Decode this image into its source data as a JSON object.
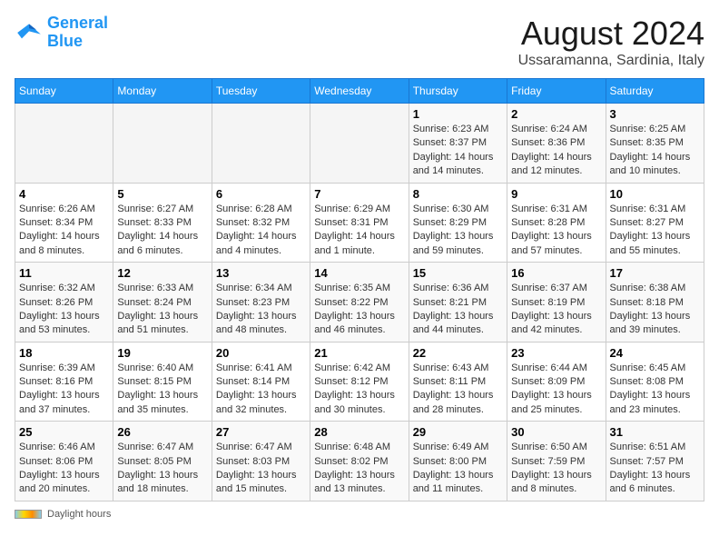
{
  "logo": {
    "line1": "General",
    "line2": "Blue"
  },
  "title": {
    "month_year": "August 2024",
    "location": "Ussaramanna, Sardinia, Italy"
  },
  "days_of_week": [
    "Sunday",
    "Monday",
    "Tuesday",
    "Wednesday",
    "Thursday",
    "Friday",
    "Saturday"
  ],
  "weeks": [
    [
      {
        "day": "",
        "info": ""
      },
      {
        "day": "",
        "info": ""
      },
      {
        "day": "",
        "info": ""
      },
      {
        "day": "",
        "info": ""
      },
      {
        "day": "1",
        "info": "Sunrise: 6:23 AM\nSunset: 8:37 PM\nDaylight: 14 hours\nand 14 minutes."
      },
      {
        "day": "2",
        "info": "Sunrise: 6:24 AM\nSunset: 8:36 PM\nDaylight: 14 hours\nand 12 minutes."
      },
      {
        "day": "3",
        "info": "Sunrise: 6:25 AM\nSunset: 8:35 PM\nDaylight: 14 hours\nand 10 minutes."
      }
    ],
    [
      {
        "day": "4",
        "info": "Sunrise: 6:26 AM\nSunset: 8:34 PM\nDaylight: 14 hours\nand 8 minutes."
      },
      {
        "day": "5",
        "info": "Sunrise: 6:27 AM\nSunset: 8:33 PM\nDaylight: 14 hours\nand 6 minutes."
      },
      {
        "day": "6",
        "info": "Sunrise: 6:28 AM\nSunset: 8:32 PM\nDaylight: 14 hours\nand 4 minutes."
      },
      {
        "day": "7",
        "info": "Sunrise: 6:29 AM\nSunset: 8:31 PM\nDaylight: 14 hours\nand 1 minute."
      },
      {
        "day": "8",
        "info": "Sunrise: 6:30 AM\nSunset: 8:29 PM\nDaylight: 13 hours\nand 59 minutes."
      },
      {
        "day": "9",
        "info": "Sunrise: 6:31 AM\nSunset: 8:28 PM\nDaylight: 13 hours\nand 57 minutes."
      },
      {
        "day": "10",
        "info": "Sunrise: 6:31 AM\nSunset: 8:27 PM\nDaylight: 13 hours\nand 55 minutes."
      }
    ],
    [
      {
        "day": "11",
        "info": "Sunrise: 6:32 AM\nSunset: 8:26 PM\nDaylight: 13 hours\nand 53 minutes."
      },
      {
        "day": "12",
        "info": "Sunrise: 6:33 AM\nSunset: 8:24 PM\nDaylight: 13 hours\nand 51 minutes."
      },
      {
        "day": "13",
        "info": "Sunrise: 6:34 AM\nSunset: 8:23 PM\nDaylight: 13 hours\nand 48 minutes."
      },
      {
        "day": "14",
        "info": "Sunrise: 6:35 AM\nSunset: 8:22 PM\nDaylight: 13 hours\nand 46 minutes."
      },
      {
        "day": "15",
        "info": "Sunrise: 6:36 AM\nSunset: 8:21 PM\nDaylight: 13 hours\nand 44 minutes."
      },
      {
        "day": "16",
        "info": "Sunrise: 6:37 AM\nSunset: 8:19 PM\nDaylight: 13 hours\nand 42 minutes."
      },
      {
        "day": "17",
        "info": "Sunrise: 6:38 AM\nSunset: 8:18 PM\nDaylight: 13 hours\nand 39 minutes."
      }
    ],
    [
      {
        "day": "18",
        "info": "Sunrise: 6:39 AM\nSunset: 8:16 PM\nDaylight: 13 hours\nand 37 minutes."
      },
      {
        "day": "19",
        "info": "Sunrise: 6:40 AM\nSunset: 8:15 PM\nDaylight: 13 hours\nand 35 minutes."
      },
      {
        "day": "20",
        "info": "Sunrise: 6:41 AM\nSunset: 8:14 PM\nDaylight: 13 hours\nand 32 minutes."
      },
      {
        "day": "21",
        "info": "Sunrise: 6:42 AM\nSunset: 8:12 PM\nDaylight: 13 hours\nand 30 minutes."
      },
      {
        "day": "22",
        "info": "Sunrise: 6:43 AM\nSunset: 8:11 PM\nDaylight: 13 hours\nand 28 minutes."
      },
      {
        "day": "23",
        "info": "Sunrise: 6:44 AM\nSunset: 8:09 PM\nDaylight: 13 hours\nand 25 minutes."
      },
      {
        "day": "24",
        "info": "Sunrise: 6:45 AM\nSunset: 8:08 PM\nDaylight: 13 hours\nand 23 minutes."
      }
    ],
    [
      {
        "day": "25",
        "info": "Sunrise: 6:46 AM\nSunset: 8:06 PM\nDaylight: 13 hours\nand 20 minutes."
      },
      {
        "day": "26",
        "info": "Sunrise: 6:47 AM\nSunset: 8:05 PM\nDaylight: 13 hours\nand 18 minutes."
      },
      {
        "day": "27",
        "info": "Sunrise: 6:47 AM\nSunset: 8:03 PM\nDaylight: 13 hours\nand 15 minutes."
      },
      {
        "day": "28",
        "info": "Sunrise: 6:48 AM\nSunset: 8:02 PM\nDaylight: 13 hours\nand 13 minutes."
      },
      {
        "day": "29",
        "info": "Sunrise: 6:49 AM\nSunset: 8:00 PM\nDaylight: 13 hours\nand 11 minutes."
      },
      {
        "day": "30",
        "info": "Sunrise: 6:50 AM\nSunset: 7:59 PM\nDaylight: 13 hours\nand 8 minutes."
      },
      {
        "day": "31",
        "info": "Sunrise: 6:51 AM\nSunset: 7:57 PM\nDaylight: 13 hours\nand 6 minutes."
      }
    ]
  ],
  "footer": {
    "daylight_label": "Daylight hours"
  }
}
